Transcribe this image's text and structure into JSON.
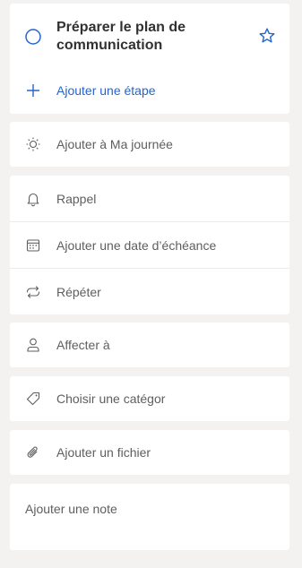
{
  "task": {
    "title": "Préparer le plan de communication",
    "add_step": "Ajouter une étape"
  },
  "my_day": {
    "label": "Ajouter à Ma journée"
  },
  "schedule": {
    "reminder": "Rappel",
    "due_date": "Ajouter une date d’échéance",
    "repeat": "Répéter"
  },
  "assign": {
    "label": "Affecter à"
  },
  "category": {
    "label": "Choisir une catégor"
  },
  "file": {
    "label": "Ajouter un fichier"
  },
  "note": {
    "placeholder": "Ajouter une note"
  },
  "colors": {
    "accent": "#2564cf",
    "background": "#f3f2f1",
    "card": "#ffffff",
    "text_primary": "#323130",
    "text_secondary": "#605e5c"
  },
  "icons": {
    "complete": "circle-outline-icon",
    "star": "star-outline-icon",
    "add": "plus-icon",
    "sun": "sun-icon",
    "reminder": "bell-icon",
    "due": "calendar-icon",
    "repeat": "repeat-icon",
    "assign": "person-icon",
    "category": "tag-icon",
    "file": "paperclip-icon"
  }
}
